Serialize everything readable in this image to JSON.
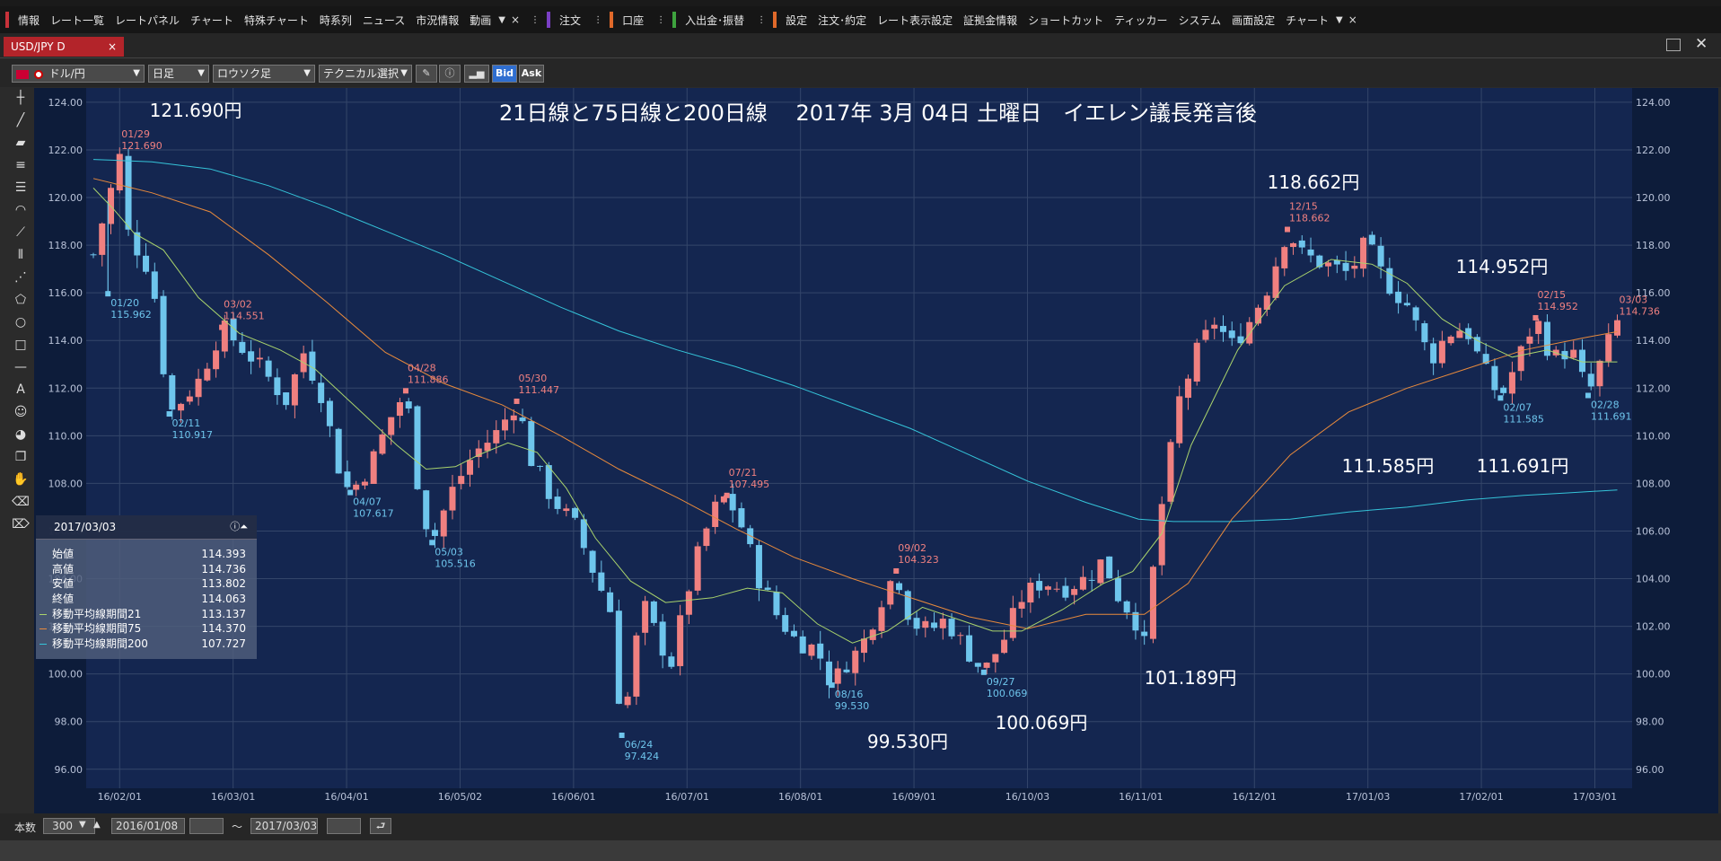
{
  "menubar": {
    "group1": [
      "情報",
      "レート一覧",
      "レートパネル",
      "チャート",
      "特殊チャート",
      "時系列",
      "ニュース",
      "市況情報",
      "動画"
    ],
    "order": "注文",
    "account": "口座",
    "deposit": "入出金･振替",
    "settings": [
      "設定",
      "注文･約定",
      "レート表示設定",
      "証拠金情報",
      "ショートカット",
      "ティッカー",
      "システム",
      "画面設定",
      "チャート"
    ],
    "colors": {
      "info": "#c8323a",
      "order": "#7a3fc4",
      "account": "#e0692a",
      "deposit": "#3ea33e",
      "settings": "#e0692a"
    }
  },
  "tab": {
    "label": "USD/JPY D",
    "close": "×"
  },
  "toolbar": {
    "pair": "ドル/円",
    "period": "日足",
    "style": "ロウソク足",
    "technical": "テクニカル選択",
    "bid": "Bid",
    "ask": "Ask"
  },
  "chart_data": {
    "type": "candlestick",
    "title": "21日線と75日線と200日線　 2017年 3月 04日 土曜日　イエレン議長発言後",
    "ylim": [
      95.2,
      124.6
    ],
    "yticks": [
      "124.00",
      "122.00",
      "120.00",
      "118.00",
      "116.00",
      "114.00",
      "112.00",
      "110.00",
      "108.00",
      "106.00",
      "104.00",
      "102.00",
      "100.00",
      "98.00",
      "96.00"
    ],
    "xticks": [
      "16/02/01",
      "16/03/01",
      "16/04/01",
      "16/05/02",
      "16/06/01",
      "16/07/01",
      "16/08/01",
      "16/09/01",
      "16/10/03",
      "16/11/01",
      "16/12/01",
      "17/01/03",
      "17/02/01",
      "17/03/01"
    ],
    "path_points": [
      [
        0,
        117.6
      ],
      [
        9,
        121.69
      ],
      [
        12,
        118.5
      ],
      [
        20,
        116.8
      ],
      [
        26,
        110.917
      ],
      [
        36,
        112.3
      ],
      [
        44,
        114.551
      ],
      [
        55,
        113.2
      ],
      [
        66,
        111.5
      ],
      [
        72,
        113.5
      ],
      [
        78,
        111.8
      ],
      [
        85,
        108.2
      ],
      [
        88,
        107.617
      ],
      [
        95,
        108.8
      ],
      [
        102,
        110.8
      ],
      [
        107,
        111.886
      ],
      [
        112,
        107.2
      ],
      [
        116,
        105.516
      ],
      [
        122,
        107.5
      ],
      [
        130,
        109.2
      ],
      [
        138,
        110.1
      ],
      [
        145,
        111.447
      ],
      [
        150,
        109.0
      ],
      [
        157,
        107.4
      ],
      [
        165,
        106.2
      ],
      [
        172,
        104.1
      ],
      [
        178,
        102.4
      ],
      [
        181,
        97.424
      ],
      [
        188,
        103.0
      ],
      [
        194,
        101.3
      ],
      [
        198,
        100.5
      ],
      [
        205,
        104.2
      ],
      [
        212,
        106.8
      ],
      [
        217,
        107.495
      ],
      [
        222,
        106.2
      ],
      [
        228,
        104.0
      ],
      [
        234,
        102.5
      ],
      [
        240,
        101.5
      ],
      [
        248,
        101.0
      ],
      [
        253,
        99.53
      ],
      [
        258,
        100.5
      ],
      [
        263,
        101.1
      ],
      [
        270,
        103.2
      ],
      [
        275,
        104.323
      ],
      [
        280,
        102.2
      ],
      [
        286,
        101.8
      ],
      [
        292,
        102.3
      ],
      [
        298,
        101.2
      ],
      [
        305,
        100.069
      ],
      [
        312,
        101.5
      ],
      [
        318,
        103.2
      ],
      [
        325,
        103.9
      ],
      [
        332,
        103.6
      ],
      [
        340,
        104.0
      ],
      [
        346,
        104.8
      ],
      [
        352,
        103.0
      ],
      [
        356,
        102.6
      ],
      [
        360,
        101.189
      ],
      [
        365,
        106.4
      ],
      [
        372,
        111.5
      ],
      [
        378,
        113.5
      ],
      [
        384,
        114.8
      ],
      [
        390,
        113.8
      ],
      [
        396,
        114.8
      ],
      [
        402,
        116.2
      ],
      [
        409,
        118.662
      ],
      [
        414,
        117.6
      ],
      [
        422,
        117.2
      ],
      [
        430,
        116.8
      ],
      [
        436,
        118.1
      ],
      [
        442,
        116.6
      ],
      [
        450,
        115.5
      ],
      [
        458,
        113.2
      ],
      [
        464,
        114.3
      ],
      [
        470,
        114.6
      ],
      [
        476,
        112.8
      ],
      [
        482,
        111.585
      ],
      [
        488,
        113.2
      ],
      [
        494,
        114.952
      ],
      [
        500,
        113.2
      ],
      [
        506,
        113.7
      ],
      [
        512,
        111.691
      ],
      [
        518,
        113.6
      ],
      [
        522,
        114.736
      ],
      [
        524,
        114.06
      ]
    ],
    "n": 525,
    "sma21": [
      [
        0,
        120.4
      ],
      [
        7,
        119.5
      ],
      [
        14,
        118.5
      ],
      [
        24,
        117.8
      ],
      [
        36,
        115.8
      ],
      [
        50,
        114.3
      ],
      [
        64,
        113.6
      ],
      [
        76,
        112.8
      ],
      [
        90,
        111.2
      ],
      [
        104,
        109.6
      ],
      [
        114,
        108.6
      ],
      [
        124,
        108.7
      ],
      [
        132,
        109.2
      ],
      [
        142,
        109.7
      ],
      [
        152,
        109.3
      ],
      [
        162,
        107.8
      ],
      [
        172,
        105.7
      ],
      [
        184,
        103.9
      ],
      [
        196,
        103.0
      ],
      [
        212,
        103.2
      ],
      [
        224,
        103.6
      ],
      [
        236,
        103.4
      ],
      [
        248,
        102.1
      ],
      [
        260,
        101.3
      ],
      [
        272,
        101.8
      ],
      [
        284,
        102.8
      ],
      [
        296,
        102.3
      ],
      [
        308,
        101.8
      ],
      [
        318,
        101.8
      ],
      [
        332,
        102.7
      ],
      [
        346,
        103.8
      ],
      [
        356,
        104.3
      ],
      [
        366,
        105.9
      ],
      [
        376,
        109.6
      ],
      [
        392,
        113.6
      ],
      [
        408,
        116.3
      ],
      [
        424,
        117.4
      ],
      [
        438,
        117.2
      ],
      [
        450,
        116.4
      ],
      [
        462,
        114.9
      ],
      [
        474,
        114.0
      ],
      [
        486,
        113.3
      ],
      [
        498,
        113.6
      ],
      [
        510,
        113.1
      ],
      [
        522,
        113.1
      ]
    ],
    "sma75": [
      [
        0,
        120.8
      ],
      [
        20,
        120.2
      ],
      [
        40,
        119.4
      ],
      [
        60,
        117.6
      ],
      [
        80,
        115.6
      ],
      [
        100,
        113.5
      ],
      [
        120,
        112.2
      ],
      [
        140,
        111.3
      ],
      [
        160,
        110.0
      ],
      [
        180,
        108.6
      ],
      [
        200,
        107.4
      ],
      [
        220,
        106.1
      ],
      [
        240,
        104.9
      ],
      [
        260,
        104.0
      ],
      [
        280,
        103.2
      ],
      [
        300,
        102.4
      ],
      [
        320,
        101.9
      ],
      [
        340,
        102.5
      ],
      [
        360,
        102.5
      ],
      [
        375,
        103.8
      ],
      [
        390,
        106.5
      ],
      [
        410,
        109.2
      ],
      [
        430,
        111.0
      ],
      [
        450,
        112.0
      ],
      [
        470,
        112.8
      ],
      [
        490,
        113.6
      ],
      [
        510,
        114.1
      ],
      [
        522,
        114.37
      ]
    ],
    "sma200": [
      [
        0,
        121.6
      ],
      [
        20,
        121.5
      ],
      [
        40,
        121.2
      ],
      [
        60,
        120.5
      ],
      [
        80,
        119.6
      ],
      [
        100,
        118.6
      ],
      [
        120,
        117.6
      ],
      [
        140,
        116.5
      ],
      [
        160,
        115.4
      ],
      [
        180,
        114.4
      ],
      [
        200,
        113.6
      ],
      [
        220,
        112.9
      ],
      [
        240,
        112.1
      ],
      [
        260,
        111.2
      ],
      [
        280,
        110.3
      ],
      [
        300,
        109.2
      ],
      [
        320,
        108.1
      ],
      [
        340,
        107.2
      ],
      [
        358,
        106.5
      ],
      [
        370,
        106.4
      ],
      [
        390,
        106.4
      ],
      [
        410,
        106.5
      ],
      [
        430,
        106.8
      ],
      [
        450,
        107.0
      ],
      [
        470,
        107.3
      ],
      [
        490,
        107.5
      ],
      [
        505,
        107.6
      ],
      [
        522,
        107.727
      ]
    ],
    "markers": [
      {
        "i": 9,
        "date": "01/29",
        "value": "121.690",
        "type": "high"
      },
      {
        "i": 44,
        "date": "03/02",
        "value": "114.551",
        "type": "high"
      },
      {
        "i": 107,
        "date": "04/28",
        "value": "111.886",
        "type": "high"
      },
      {
        "i": 145,
        "date": "05/30",
        "value": "111.447",
        "type": "high"
      },
      {
        "i": 217,
        "date": "07/21",
        "value": "107.495",
        "type": "high"
      },
      {
        "i": 275,
        "date": "09/02",
        "value": "104.323",
        "type": "high"
      },
      {
        "i": 409,
        "date": "12/15",
        "value": "118.662",
        "type": "high"
      },
      {
        "i": 494,
        "date": "02/15",
        "value": "114.952",
        "type": "high"
      },
      {
        "i": 522,
        "date": "03/03",
        "value": "114.736",
        "type": "high"
      },
      {
        "i": 5,
        "date": "01/20",
        "value": "115.962",
        "type": "low"
      },
      {
        "i": 26,
        "date": "02/11",
        "value": "110.917",
        "type": "low"
      },
      {
        "i": 88,
        "date": "04/07",
        "value": "107.617",
        "type": "low"
      },
      {
        "i": 116,
        "date": "05/03",
        "value": "105.516",
        "type": "low"
      },
      {
        "i": 181,
        "date": "06/24",
        "value": "97.424",
        "type": "low"
      },
      {
        "i": 253,
        "date": "08/16",
        "value": "99.530",
        "type": "low"
      },
      {
        "i": 305,
        "date": "09/27",
        "value": "100.069",
        "type": "low"
      },
      {
        "i": 482,
        "date": "02/07",
        "value": "111.585",
        "type": "low"
      },
      {
        "i": 512,
        "date": "02/28",
        "value": "111.691",
        "type": "low"
      }
    ],
    "annotations": [
      "121.690円",
      "118.662円",
      "114.952円",
      "111.585円",
      "111.691円",
      "101.189円",
      "100.069円",
      "99.530円"
    ],
    "colors": {
      "bg": "#0d1c3a",
      "up": "#f08080",
      "down": "#6ec5ec",
      "sma21": "#a9d36c",
      "sma75": "#e88a3c",
      "sma200": "#35c4d9",
      "grid": "#34466a"
    }
  },
  "infobox": {
    "date": "2017/03/03",
    "rows": [
      {
        "label": "始値",
        "value": "114.393"
      },
      {
        "label": "高値",
        "value": "114.736"
      },
      {
        "label": "安値",
        "value": "113.802"
      },
      {
        "label": "終値",
        "value": "114.063"
      },
      {
        "label": "移動平均線期間21",
        "value": "113.137"
      },
      {
        "label": "移動平均線期間75",
        "value": "114.370"
      },
      {
        "label": "移動平均線期間200",
        "value": "107.727"
      }
    ]
  },
  "footer": {
    "count_label": "本数",
    "count": "300",
    "from": "2016/01/08",
    "tilde": "～",
    "to": "2017/03/03"
  }
}
